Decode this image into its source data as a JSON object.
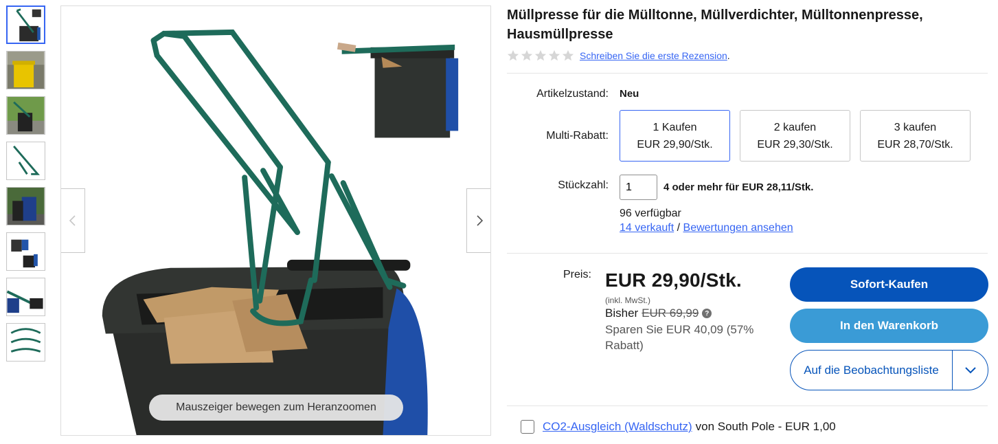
{
  "gallery": {
    "thumbnails": [
      {
        "name": "thumb-1",
        "active": true
      },
      {
        "name": "thumb-2",
        "active": false
      },
      {
        "name": "thumb-3",
        "active": false
      },
      {
        "name": "thumb-4",
        "active": false
      },
      {
        "name": "thumb-5",
        "active": false
      },
      {
        "name": "thumb-6",
        "active": false
      },
      {
        "name": "thumb-7",
        "active": false
      },
      {
        "name": "thumb-8",
        "active": false
      }
    ],
    "zoom_hint": "Mauszeiger bewegen zum Heranzoomen",
    "prev_icon": "chevron-left-icon",
    "next_icon": "chevron-right-icon"
  },
  "product": {
    "title": "Müllpresse für die Mülltonne, Müllverdichter, Mülltonnenpresse, Hausmüllpresse",
    "rating_stars": 0,
    "review_link": "Schreiben Sie die erste Rezension",
    "review_suffix": "."
  },
  "details": {
    "condition_label": "Artikelzustand:",
    "condition_value": "Neu",
    "multi_label": "Multi-Rabatt:",
    "multi_options": [
      {
        "qty": "1 Kaufen",
        "price": "EUR 29,90/Stk.",
        "selected": true
      },
      {
        "qty": "2 kaufen",
        "price": "EUR 29,30/Stk.",
        "selected": false
      },
      {
        "qty": "3 kaufen",
        "price": "EUR 28,70/Stk.",
        "selected": false
      }
    ],
    "qty_label": "Stückzahl:",
    "qty_value": "1",
    "qty_note": "4 oder mehr für EUR 28,11/Stk.",
    "available": "96 verfügbar",
    "sold_link": "14 verkauft",
    "separator": "/",
    "ratings_link": "Bewertungen ansehen"
  },
  "pricing": {
    "price_label": "Preis:",
    "price": "EUR 29,90/Stk.",
    "vat": "(inkl. MwSt.)",
    "was_label": "Bisher",
    "was_price": "EUR 69,99",
    "savings": "Sparen Sie EUR 40,09 (57% Rabatt)"
  },
  "actions": {
    "buy_now": "Sofort-Kaufen",
    "add_to_cart": "In den Warenkorb",
    "watchlist": "Auf die Beobachtungsliste"
  },
  "co2": {
    "link": "CO2-Ausgleich (Waldschutz)",
    "text": "von South Pole - EUR 1,00"
  },
  "colors": {
    "brand_blue": "#0654ba",
    "cart_blue": "#3a9bd6",
    "link_blue": "#3665f3"
  }
}
